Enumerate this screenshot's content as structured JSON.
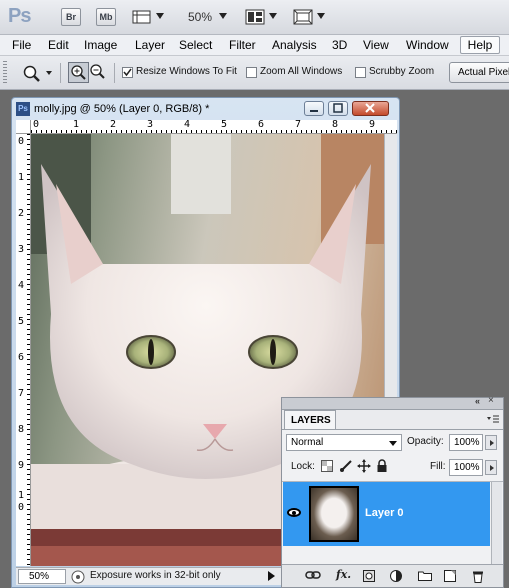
{
  "appbar": {
    "logo": "Ps",
    "bridge_label": "Br",
    "minibridge_label": "Mb",
    "zoom_level": "50%"
  },
  "menu": {
    "items": [
      "File",
      "Edit",
      "Image",
      "Layer",
      "Select",
      "Filter",
      "Analysis",
      "3D",
      "View",
      "Window"
    ],
    "help": "Help"
  },
  "options": {
    "resize_windows": "Resize Windows To Fit",
    "zoom_all_windows": "Zoom All Windows",
    "scrubby_zoom": "Scrubby Zoom",
    "actual_pixels": "Actual Pixels"
  },
  "document": {
    "icon_label": "Ps",
    "title": "molly.jpg @ 50% (Layer 0, RGB/8) *",
    "ruler_top": [
      "0",
      "1",
      "2",
      "3",
      "4",
      "5",
      "6",
      "7",
      "8",
      "9"
    ],
    "ruler_left": [
      "0",
      "1",
      "2",
      "3",
      "4",
      "5",
      "6",
      "7",
      "8",
      "9",
      "1",
      "0"
    ],
    "status_zoom": "50%",
    "status_text": "Exposure works in 32-bit only"
  },
  "layers": {
    "tab": "LAYERS",
    "blend_mode": "Normal",
    "opacity_label": "Opacity:",
    "opacity_value": "100%",
    "lock_label": "Lock:",
    "fill_label": "Fill:",
    "fill_value": "100%",
    "layer_name": "Layer 0"
  }
}
